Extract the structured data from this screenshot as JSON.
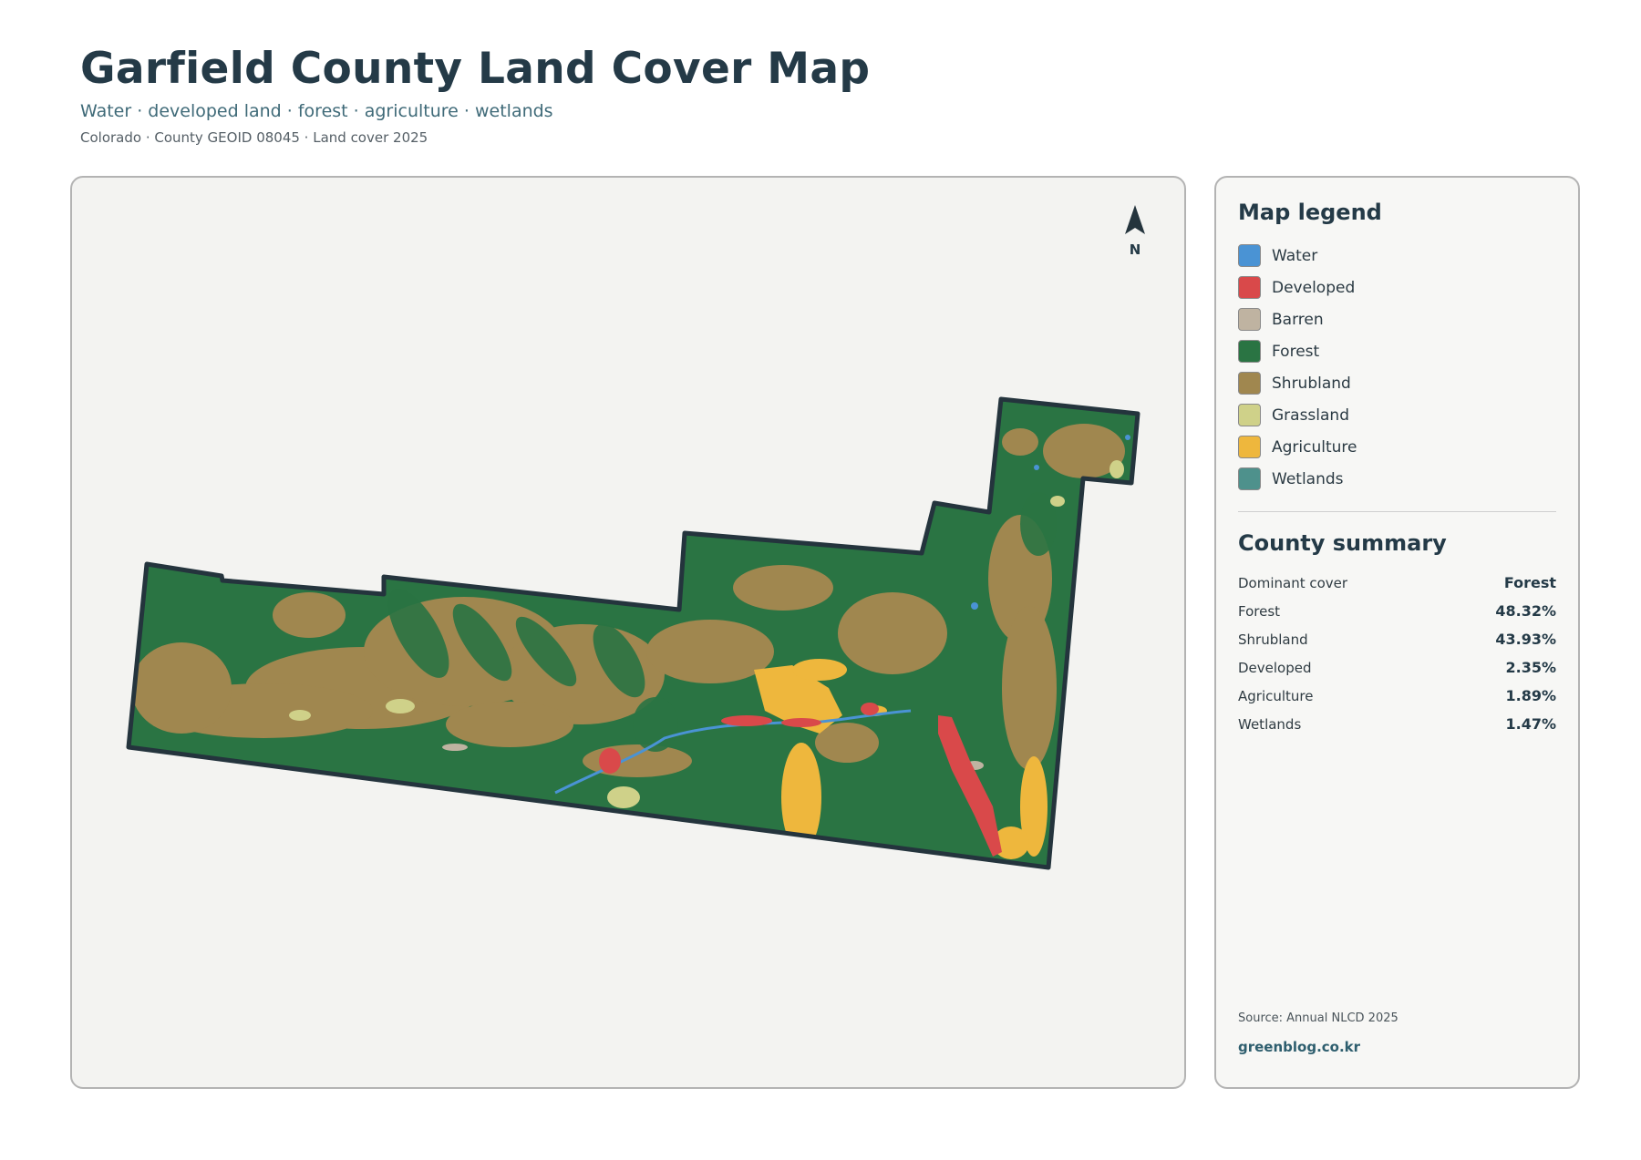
{
  "header": {
    "title": "Garfield County Land Cover Map",
    "subtitle": "Water · developed land · forest · agriculture · wetlands",
    "meta": "Colorado · County GEOID 08045 · Land cover 2025"
  },
  "map": {
    "north_label": "N",
    "colors": {
      "water": "#4a93d4",
      "developed": "#d9494a",
      "barren": "#bfb3a1",
      "forest": "#2a7443",
      "shrubland": "#a0874f",
      "grassland": "#cfd189",
      "agriculture": "#eeb73d",
      "wetlands": "#4e918c",
      "boundary": "#24343d"
    }
  },
  "legend": {
    "title": "Map legend",
    "items": [
      {
        "label": "Water",
        "color": "#4a93d4"
      },
      {
        "label": "Developed",
        "color": "#d9494a"
      },
      {
        "label": "Barren",
        "color": "#bfb3a1"
      },
      {
        "label": "Forest",
        "color": "#2a7443"
      },
      {
        "label": "Shrubland",
        "color": "#a0874f"
      },
      {
        "label": "Grassland",
        "color": "#cfd189"
      },
      {
        "label": "Agriculture",
        "color": "#eeb73d"
      },
      {
        "label": "Wetlands",
        "color": "#4e918c"
      }
    ]
  },
  "summary": {
    "title": "County summary",
    "rows": [
      {
        "key": "Dominant cover",
        "value": "Forest"
      },
      {
        "key": "Forest",
        "value": "48.32%"
      },
      {
        "key": "Shrubland",
        "value": "43.93%"
      },
      {
        "key": "Developed",
        "value": "2.35%"
      },
      {
        "key": "Agriculture",
        "value": "1.89%"
      },
      {
        "key": "Wetlands",
        "value": "1.47%"
      }
    ]
  },
  "footer": {
    "source": "Source: Annual NLCD 2025",
    "site": "greenblog.co.kr"
  }
}
